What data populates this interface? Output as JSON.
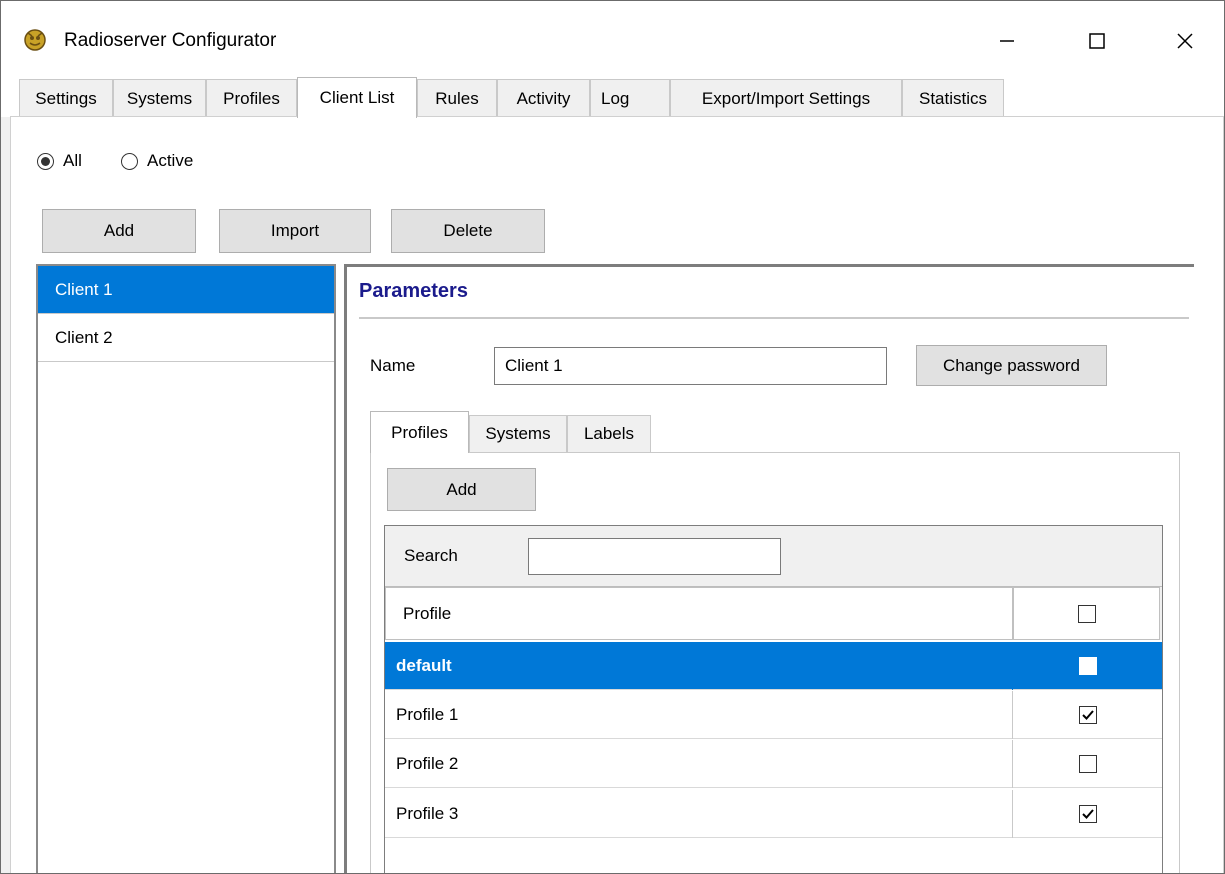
{
  "window": {
    "title": "Radioserver Configurator",
    "minimize_glyph": "—",
    "maximize_glyph": "☐",
    "close_glyph": "✕"
  },
  "tabs": [
    {
      "label": "Settings"
    },
    {
      "label": "Systems"
    },
    {
      "label": "Profiles"
    },
    {
      "label": "Client List",
      "active": true
    },
    {
      "label": "Rules"
    },
    {
      "label": "Activity"
    },
    {
      "label": "Log"
    },
    {
      "label": "Export/Import Settings"
    },
    {
      "label": "Statistics"
    }
  ],
  "filter": {
    "all_label": "All",
    "active_label": "Active",
    "selected": "All"
  },
  "toolbar": {
    "add_label": "Add",
    "import_label": "Import",
    "delete_label": "Delete"
  },
  "clients": [
    {
      "label": "Client 1",
      "selected": true
    },
    {
      "label": "Client 2",
      "selected": false
    }
  ],
  "parameters": {
    "title": "Parameters",
    "name_label": "Name",
    "name_value": "Client 1",
    "change_password_label": "Change password"
  },
  "subtabs": [
    {
      "label": "Profiles",
      "active": true
    },
    {
      "label": "Systems"
    },
    {
      "label": "Labels"
    }
  ],
  "profiles_panel": {
    "add_label": "Add",
    "search_label": "Search",
    "search_value": "",
    "column_profile": "Profile",
    "rows": [
      {
        "name": "default",
        "checked": false,
        "selected": true
      },
      {
        "name": "Profile 1",
        "checked": true,
        "selected": false
      },
      {
        "name": "Profile 2",
        "checked": false,
        "selected": false
      },
      {
        "name": "Profile 3",
        "checked": true,
        "selected": false
      }
    ]
  },
  "colors": {
    "selection": "#0078d7",
    "parameters_title": "#1b1b8c"
  }
}
